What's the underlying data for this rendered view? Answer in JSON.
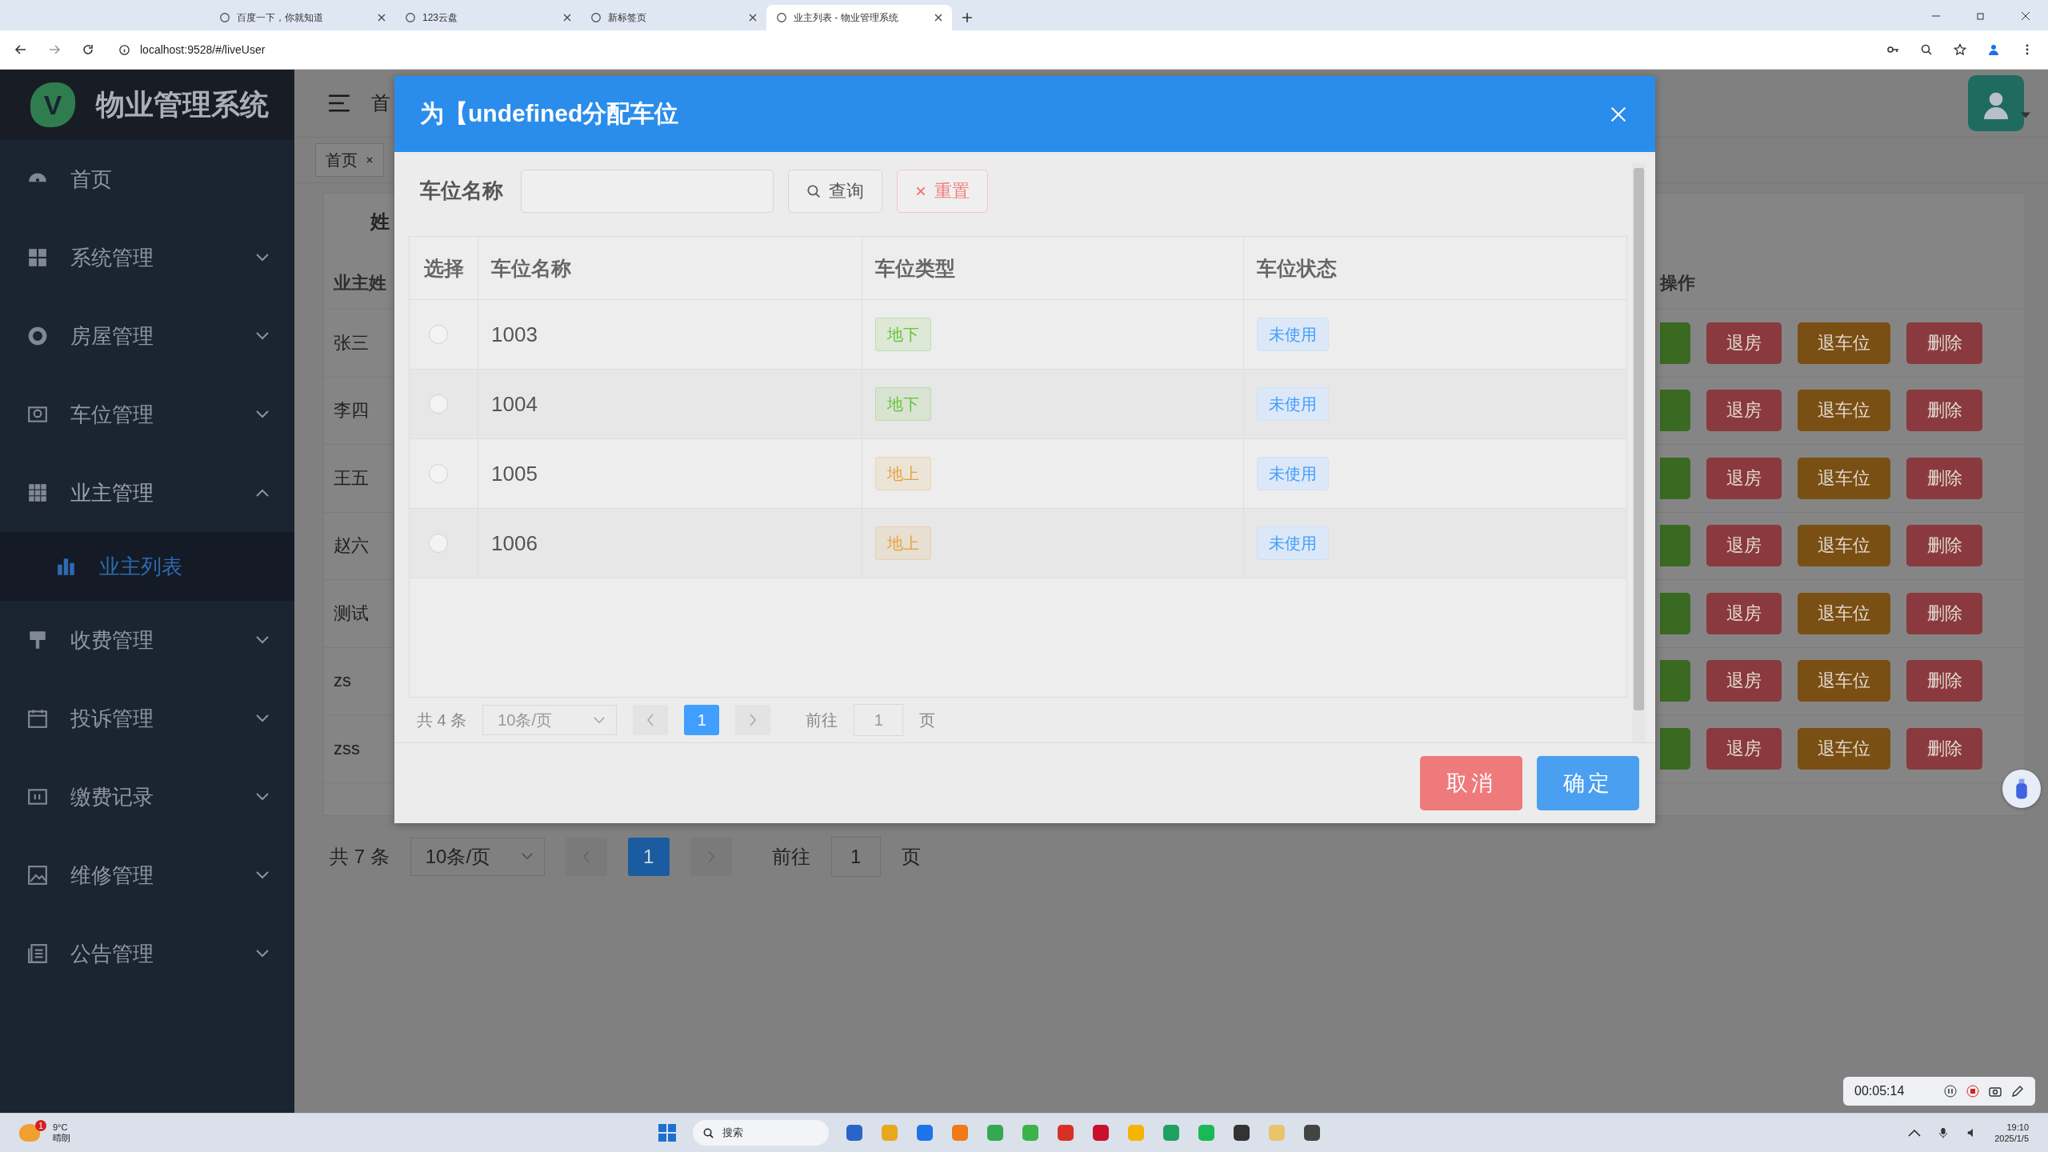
{
  "browser": {
    "tabs": [
      {
        "label": "百度一下，你就知道",
        "selected": false
      },
      {
        "label": "123云盘",
        "selected": false
      },
      {
        "label": "新标签页",
        "selected": false
      },
      {
        "label": "业主列表 - 物业管理系统",
        "selected": true
      }
    ],
    "address": "localhost:9528/#/liveUser"
  },
  "sidebar": {
    "logo_letter": "V",
    "title": "物业管理系统",
    "items": [
      {
        "label": "首页",
        "kind": "link"
      },
      {
        "label": "系统管理",
        "kind": "submenu",
        "expanded": false
      },
      {
        "label": "房屋管理",
        "kind": "submenu",
        "expanded": false
      },
      {
        "label": "车位管理",
        "kind": "submenu",
        "expanded": false
      },
      {
        "label": "业主管理",
        "kind": "submenu",
        "expanded": true,
        "children": [
          {
            "label": "业主列表",
            "selected": true
          }
        ]
      },
      {
        "label": "收费管理",
        "kind": "submenu",
        "expanded": false
      },
      {
        "label": "投诉管理",
        "kind": "submenu",
        "expanded": false
      },
      {
        "label": "缴费记录",
        "kind": "submenu",
        "expanded": false
      },
      {
        "label": "维修管理",
        "kind": "submenu",
        "expanded": false
      },
      {
        "label": "公告管理",
        "kind": "submenu",
        "expanded": false
      }
    ]
  },
  "header": {
    "breadcrumb": "首",
    "tag": "首页"
  },
  "page": {
    "search_label": "姓",
    "name_column": "业主姓",
    "actions_column": "操作",
    "rows": [
      {
        "name": "张三",
        "actions": [
          "退房",
          "退车位",
          "删除"
        ]
      },
      {
        "name": "李四",
        "actions": [
          "退房",
          "退车位",
          "删除"
        ]
      },
      {
        "name": "王五",
        "actions": [
          "退房",
          "退车位",
          "删除"
        ]
      },
      {
        "name": "赵六",
        "actions": [
          "退房",
          "退车位",
          "删除"
        ]
      },
      {
        "name": "测试",
        "actions": [
          "退房",
          "退车位",
          "删除"
        ]
      },
      {
        "name": "zs",
        "actions": [
          "退房",
          "退车位",
          "删除"
        ]
      },
      {
        "name": "zss",
        "actions": [
          "退房",
          "退车位",
          "删除"
        ]
      }
    ],
    "pagination": {
      "total": "共 7 条",
      "page_size": "10条/页",
      "pages": [
        {
          "label": "1",
          "selected": true
        }
      ],
      "goto": "前往",
      "goto_value": "1",
      "goto_suffix": "页"
    }
  },
  "modal": {
    "title": "为【undefined分配车位",
    "search_label": "车位名称",
    "search_button": "查询",
    "reset_button": "重置",
    "columns": [
      "选择",
      "车位名称",
      "车位类型",
      "车位状态"
    ],
    "rows": [
      {
        "name": "1003",
        "type": "地下",
        "color": "#67c23a",
        "status": "未使用",
        "selected": false
      },
      {
        "name": "1004",
        "type": "地下",
        "color": "#67c23a",
        "status": "未使用",
        "selected": false
      },
      {
        "name": "1005",
        "type": "地上",
        "color": "#e6a23c",
        "status": "未使用",
        "selected": false
      },
      {
        "name": "1006",
        "type": "地上",
        "color": "#e6a23c",
        "status": "未使用",
        "selected": false
      }
    ],
    "pagination": {
      "total": "共 4 条",
      "page_size": "10条/页",
      "pages": [
        {
          "label": "1",
          "selected": true
        }
      ],
      "goto": "前往",
      "goto_value": "1",
      "goto_suffix": "页"
    },
    "cancel_button": "取消",
    "confirm_button": "确定"
  },
  "recorder": {
    "time": "00:05:14"
  },
  "taskbar": {
    "temperature": "9°C",
    "weather": "晴朗",
    "weather_badge": "1",
    "search_placeholder": "搜索",
    "time": "19:10",
    "date": "2025/1/5"
  }
}
